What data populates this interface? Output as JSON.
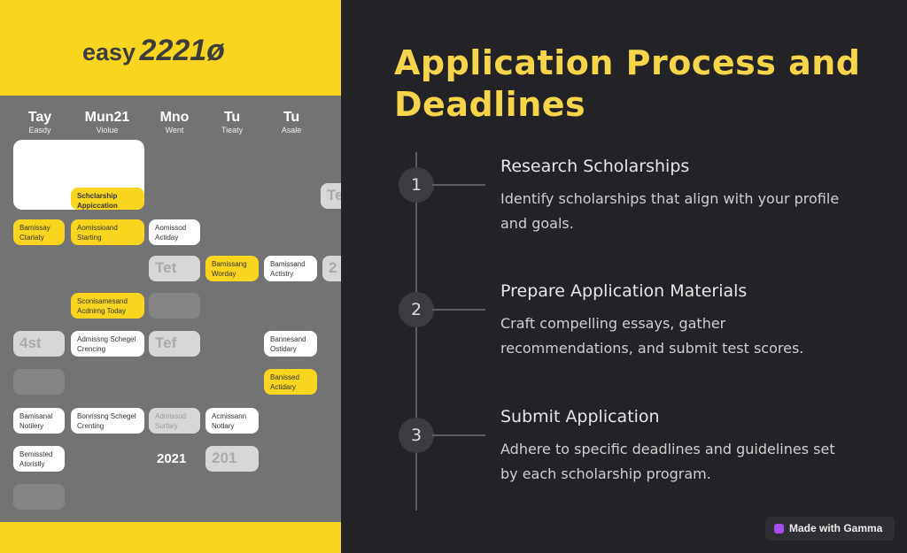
{
  "image": {
    "logo": {
      "word": "easy",
      "number": "2221ø"
    },
    "days": [
      {
        "d": "Tay",
        "s": "Easdy"
      },
      {
        "d": "Mun21",
        "s": "Violue"
      },
      {
        "d": "Mno",
        "s": "Went"
      },
      {
        "d": "Tu",
        "s": "Tieaty"
      },
      {
        "d": "Tu",
        "s": "Asale"
      }
    ],
    "cards": [
      "Schclarship Appiccation",
      "Bamissay Ctariaty",
      "Aomissioand Starting",
      "Aomissod Actiday",
      "Tet",
      "Bamissang Worday",
      "Bamissand Actistry",
      "Sconisamesand Acdnirng Today",
      "4st",
      "Admissng Schegel Crencing",
      "Tef",
      "Bannesand Ostidary",
      "Banissed Actidary",
      "Bamisanal Notilery",
      "Bonrissng Schegel Crenting",
      "Admissod Surfary",
      "Acmissann Notlary",
      "Bemissted Atoristly",
      "2021",
      "201",
      "Te",
      "2"
    ]
  },
  "slide": {
    "title": "Application Process and Deadlines",
    "steps": [
      {
        "n": "1",
        "title": "Research Scholarships",
        "desc": "Identify scholarships that align with your profile and goals."
      },
      {
        "n": "2",
        "title": "Prepare Application Materials",
        "desc": "Craft compelling essays, gather recommendations, and submit test scores."
      },
      {
        "n": "3",
        "title": "Submit Application",
        "desc": "Adhere to specific deadlines and guidelines set by each scholarship program."
      }
    ]
  },
  "badge": {
    "label": "Made with Gamma",
    "icon": "gamma-logo-icon"
  },
  "colors": {
    "accent": "#f7d54a",
    "yellow": "#fad51f",
    "background": "#232226"
  }
}
